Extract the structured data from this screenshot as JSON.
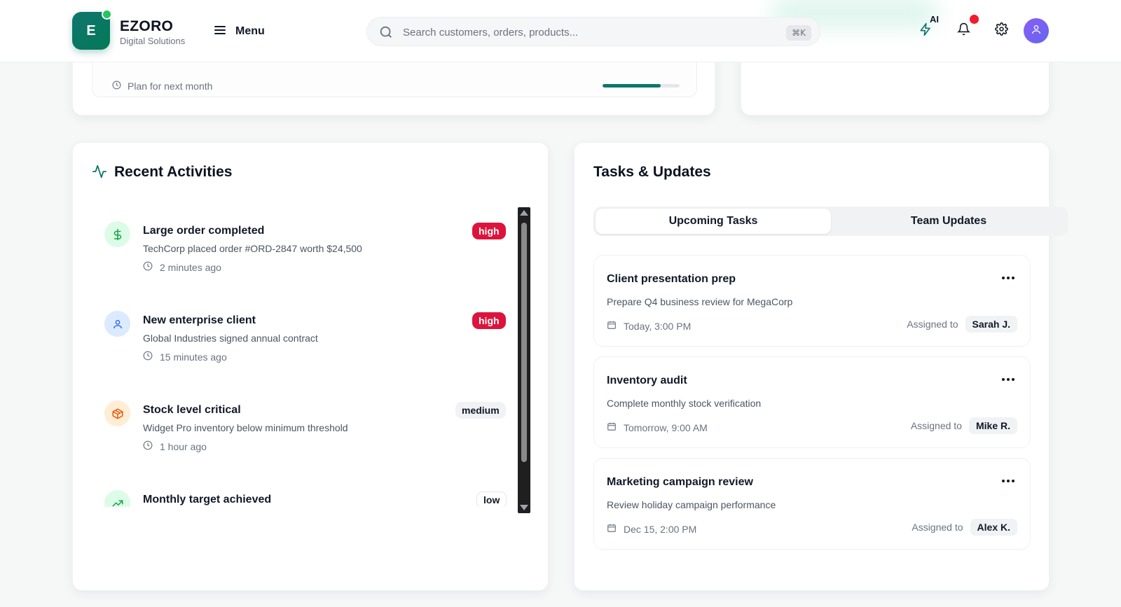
{
  "brand": {
    "initial": "E",
    "name": "EZORO",
    "subtitle": "Digital Solutions"
  },
  "header": {
    "menu_label": "Menu",
    "search_placeholder": "Search customers, orders, products...",
    "search_shortcut": "⌘K",
    "ai_label": "AI",
    "icons": [
      "bolt-icon",
      "bell-icon",
      "gear-icon",
      "user-icon"
    ]
  },
  "goal_card": {
    "meta": "Plan for next month",
    "progress_percent": 75
  },
  "activities": {
    "title": "Recent Activities",
    "items": [
      {
        "icon": "dollar-icon",
        "title": "Large order completed",
        "desc": "TechCorp placed order #ORD-2847 worth $24,500",
        "time": "2 minutes ago",
        "priority": "high"
      },
      {
        "icon": "user-icon",
        "title": "New enterprise client",
        "desc": "Global Industries signed annual contract",
        "time": "15 minutes ago",
        "priority": "high"
      },
      {
        "icon": "package-icon",
        "title": "Stock level critical",
        "desc": "Widget Pro inventory below minimum threshold",
        "time": "1 hour ago",
        "priority": "medium"
      },
      {
        "icon": "trending-up-icon",
        "title": "Monthly target achieved",
        "desc": "",
        "time": "",
        "priority": "low"
      }
    ]
  },
  "tasks": {
    "title": "Tasks & Updates",
    "tabs": [
      {
        "label": "Upcoming Tasks",
        "active": true
      },
      {
        "label": "Team Updates",
        "active": false
      }
    ],
    "assigned_label": "Assigned to",
    "items": [
      {
        "title": "Client presentation prep",
        "desc": "Prepare Q4 business review for MegaCorp",
        "date": "Today, 3:00 PM",
        "assignee": "Sarah J."
      },
      {
        "title": "Inventory audit",
        "desc": "Complete monthly stock verification",
        "date": "Tomorrow, 9:00 AM",
        "assignee": "Mike R."
      },
      {
        "title": "Marketing campaign review",
        "desc": "Review holiday campaign performance",
        "date": "Dec 15, 2:00 PM",
        "assignee": "Alex K."
      }
    ]
  },
  "colors": {
    "brand": "#0f766e",
    "high": "#dc143c",
    "notification": "#ef1c2c",
    "avatar": "#8b5cf6"
  }
}
